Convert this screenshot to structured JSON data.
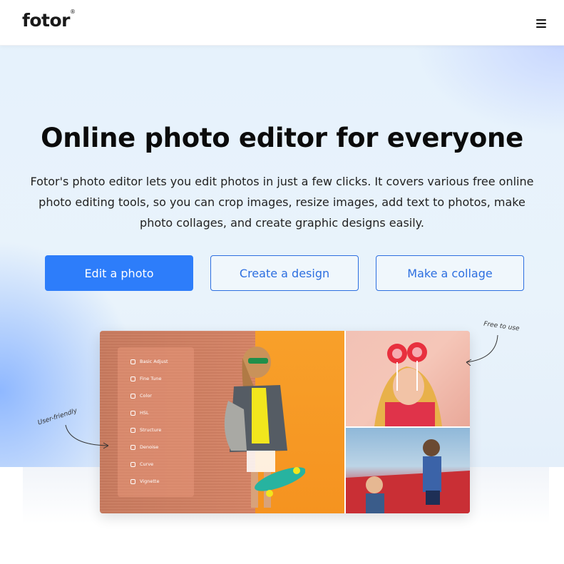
{
  "header": {
    "logo_text": "fotor",
    "logo_mark": "®",
    "menu_icon": "hamburger-menu-icon"
  },
  "hero": {
    "title": "Online photo editor for everyone",
    "description": "Fotor's photo editor lets you edit photos in just a few clicks. It covers various free online photo editing tools, so you can crop images, resize images, add text to photos, make photo collages, and create graphic designs easily.",
    "buttons": {
      "edit_photo": "Edit a photo",
      "create_design": "Create a design",
      "make_collage": "Make a collage"
    }
  },
  "showcase": {
    "notes": {
      "free": "Free to use",
      "friendly": "User-friendly"
    },
    "adjust_items": [
      "Basic Adjust",
      "Fine Tune",
      "Color",
      "HSL",
      "Structure",
      "Denoise",
      "Curve",
      "Vignette"
    ]
  },
  "colors": {
    "accent": "#2d7dfa",
    "outline": "#2d6fe0"
  }
}
